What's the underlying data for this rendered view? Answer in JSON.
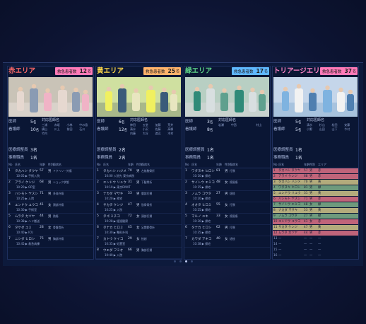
{
  "colors": {
    "red_title": "#ff6a6a",
    "yellow_title": "#ffd84a",
    "green_title": "#5fd68a",
    "triage_title": "#ff83c8",
    "badge_pink": "#ff7ab8",
    "badge_orange": "#ffb36b",
    "badge_blue": "#5fb8ff",
    "tri_red": "#c0647a",
    "tri_yellow": "#b3ab7c",
    "tri_green": "#6e9a7d",
    "tri_gray": "#4e5f85"
  },
  "labels": {
    "badge": "救急患者数",
    "unit": "名",
    "doctor": "医師",
    "nurse": "看護師",
    "coordinator": "医療調整員",
    "admin": "事務職員",
    "responders": "対応医師名",
    "col_no": "No",
    "col_name": "氏名",
    "col_age": "年齢",
    "col_sex": "性別",
    "col_diag": "傷病名",
    "col_area": "エリア"
  },
  "panels": [
    {
      "title": "赤エリア",
      "count": "12",
      "doctor": "5",
      "nurse": "10",
      "coordinator": "3",
      "admin": "1",
      "names": [
        "三浦",
        "赤坂",
        "小林",
        "中の島",
        "横山",
        "川上",
        "前田",
        "石川",
        "竹内",
        "",
        "",
        ""
      ],
      "patients": [
        {
          "no": "1",
          "name": "タカハシ タクヤ",
          "age": "57",
          "sex": "男",
          "diag": "ドクヘリ・外傷",
          "sub": "10:05  ▶ 手術入院"
        },
        {
          "no": "2",
          "name": "アライ ケンジ",
          "age": "68",
          "sex": "男",
          "diag": "ショック状態",
          "sub": "10:20  ▶ OP室"
        },
        {
          "no": "3",
          "name": "ハシモト ヤスシ",
          "age": "71",
          "sex": "男",
          "diag": "多発外傷",
          "sub": "10:25  ▶ 入院"
        },
        {
          "no": "4",
          "name": "エンドウ ユウコ",
          "age": "41",
          "sex": "女",
          "diag": "頭部外傷",
          "sub": "10:30  ▶ 手術室"
        },
        {
          "no": "5",
          "name": "ムラタ カツヤ",
          "age": "44",
          "sex": "男",
          "diag": "熱傷",
          "sub": "10:38  ▶ ヘリ搬送"
        },
        {
          "no": "6",
          "name": "タケダ ユミ",
          "age": "28",
          "sex": "女",
          "diag": "骨盤骨折",
          "sub": "10:40  ▶ ICU"
        },
        {
          "no": "7",
          "name": "ニシダ ヒロシ",
          "age": "75",
          "sex": "男",
          "diag": "胸部外傷",
          "sub": "10:45  ▶ 救急病棟"
        }
      ]
    },
    {
      "title": "黄エリア",
      "count": "25",
      "doctor": "6",
      "nurse": "12",
      "coordinator": "2",
      "admin": "2",
      "names": [
        "神田",
        "五堂",
        "加藤",
        "荒井",
        "清水",
        "小沢",
        "佐藤",
        "高柳",
        "内藤",
        "大谷",
        "渡辺",
        "木村"
      ],
      "patients": [
        {
          "no": "1",
          "name": "タカハシ ハジメ",
          "age": "70",
          "sex": "男",
          "diag": "左前腕骨折",
          "sub": "10:00  入院先 東京病院"
        },
        {
          "no": "2",
          "name": "エンドウ リュウ",
          "age": "31",
          "sex": "男",
          "diag": "下腿骨折",
          "sub": "10:10  ▶ 東京DMAT"
        },
        {
          "no": "3",
          "name": "ナカダ マサキ",
          "age": "53",
          "sex": "男",
          "diag": "腰部打撲",
          "sub": "10:20  ▶ 帰宅"
        },
        {
          "no": "4",
          "name": "サカタ ケンジ",
          "age": "47",
          "sex": "男",
          "diag": "肋骨骨折",
          "sub": "10:25  ▶ 入院"
        },
        {
          "no": "5",
          "name": "タゴ ミチコ",
          "age": "72",
          "sex": "女",
          "diag": "頭部打撲",
          "sub": "10:28  ▶ 経過観察"
        },
        {
          "no": "6",
          "name": "タナカ ヒロミ",
          "age": "45",
          "sex": "女",
          "diag": "足関節骨折",
          "sub": "10:30  ▶ 整形外科"
        },
        {
          "no": "7",
          "name": "カトウ ケイコ",
          "age": "29",
          "sex": "女",
          "diag": "挫創",
          "sub": "10:35  ▶ 処置室"
        },
        {
          "no": "8",
          "name": "ウエダ フミオ",
          "age": "66",
          "sex": "男",
          "diag": "胸部打撲",
          "sub": "10:40  ▶ 入院"
        }
      ]
    },
    {
      "title": "緑エリア",
      "count": "17",
      "doctor": "3",
      "nurse": "8",
      "coordinator": "1",
      "admin": "1",
      "names": [
        "岩瀬",
        "中西",
        "",
        "村山",
        "",
        "",
        "",
        "",
        "",
        "",
        "",
        ""
      ],
      "patients": [
        {
          "no": "1",
          "name": "ワタヌキ ヒロシ",
          "age": "81",
          "sex": "男",
          "diag": "打撲",
          "sub": "10:10  ▶ 帰宅"
        },
        {
          "no": "2",
          "name": "サイトウ エミコ",
          "age": "48",
          "sex": "女",
          "diag": "擦過傷",
          "sub": "10:15  ▶ 帰宅"
        },
        {
          "no": "3",
          "name": "ノムラ コウタ",
          "age": "27",
          "sex": "男",
          "diag": "捻挫",
          "sub": "10:20  ▶ 帰宅"
        },
        {
          "no": "4",
          "name": "オオタ ヒロミ",
          "age": "55",
          "sex": "女",
          "diag": "打撲",
          "sub": "10:25  ▶ 帰宅"
        },
        {
          "no": "5",
          "name": "マルノ ユキ",
          "age": "33",
          "sex": "女",
          "diag": "擦過傷",
          "sub": "10:30  ▶ 帰宅"
        },
        {
          "no": "6",
          "name": "タナカ ヒロシ",
          "age": "62",
          "sex": "男",
          "diag": "打撲",
          "sub": "10:35  ▶ 帰宅"
        },
        {
          "no": "7",
          "name": "カワダ アキコ",
          "age": "40",
          "sex": "女",
          "diag": "捻挫",
          "sub": "10:38  ▶ 帰宅"
        }
      ]
    },
    {
      "title": "トリアージエリア",
      "count": "37",
      "doctor": "5",
      "nurse": "5",
      "coordinator": "1",
      "admin": "1",
      "names": [
        "清水",
        "杉山",
        "松田",
        "安藤",
        "小野",
        "山田",
        "山下",
        "今村",
        "",
        "",
        "",
        ""
      ],
      "triage_rows": [
        {
          "no": "1",
          "name": "タカハシ タクヤ",
          "age": "57",
          "sex": "男",
          "area": "赤",
          "color": "red"
        },
        {
          "no": "2",
          "name": "アライ ケンジ",
          "age": "68",
          "sex": "男",
          "area": "赤",
          "color": "red"
        },
        {
          "no": "3",
          "name": "タカハシ ハジメ",
          "age": "70",
          "sex": "男",
          "area": "黄",
          "color": "yellow"
        },
        {
          "no": "4",
          "name": "ワタヌキ ヒロシ",
          "age": "81",
          "sex": "男",
          "area": "緑",
          "color": "green"
        },
        {
          "no": "5",
          "name": "エンドウ リュウ",
          "age": "31",
          "sex": "男",
          "area": "黄",
          "color": "yellow"
        },
        {
          "no": "6",
          "name": "ハシモト ヤスシ",
          "age": "71",
          "sex": "男",
          "area": "赤",
          "color": "red"
        },
        {
          "no": "7",
          "name": "サイトウ エミコ",
          "age": "48",
          "sex": "女",
          "area": "緑",
          "color": "green"
        },
        {
          "no": "8",
          "name": "ナカダ マサキ",
          "age": "53",
          "sex": "男",
          "area": "黄",
          "color": "yellow"
        },
        {
          "no": "9",
          "name": "ノムラ コウタ",
          "age": "27",
          "sex": "男",
          "area": "緑",
          "color": "green"
        },
        {
          "no": "10",
          "name": "エンドウ ユウコ",
          "age": "41",
          "sex": "女",
          "area": "赤",
          "color": "red"
        },
        {
          "no": "11",
          "name": "サカタ ケンジ",
          "age": "47",
          "sex": "男",
          "area": "黄",
          "color": "yellow"
        },
        {
          "no": "12",
          "name": "ムラタ カツヤ",
          "age": "44",
          "sex": "男",
          "area": "赤",
          "color": "red"
        },
        {
          "no": "13",
          "name": "—",
          "age": "—",
          "sex": "—",
          "area": "—",
          "color": "none"
        },
        {
          "no": "14",
          "name": "—",
          "age": "—",
          "sex": "—",
          "area": "—",
          "color": "none"
        },
        {
          "no": "15",
          "name": "—",
          "age": "—",
          "sex": "—",
          "area": "—",
          "color": "none"
        },
        {
          "no": "16",
          "name": "—",
          "age": "—",
          "sex": "—",
          "area": "—",
          "color": "none"
        },
        {
          "no": "17",
          "name": "—",
          "age": "—",
          "sex": "—",
          "area": "—",
          "color": "none"
        },
        {
          "no": "18",
          "name": "—",
          "age": "—",
          "sex": "—",
          "area": "—",
          "color": "none"
        },
        {
          "no": "19",
          "name": "—",
          "age": "—",
          "sex": "—",
          "area": "—",
          "color": "none"
        }
      ]
    }
  ],
  "pager": {
    "count": 4,
    "active": 2
  }
}
